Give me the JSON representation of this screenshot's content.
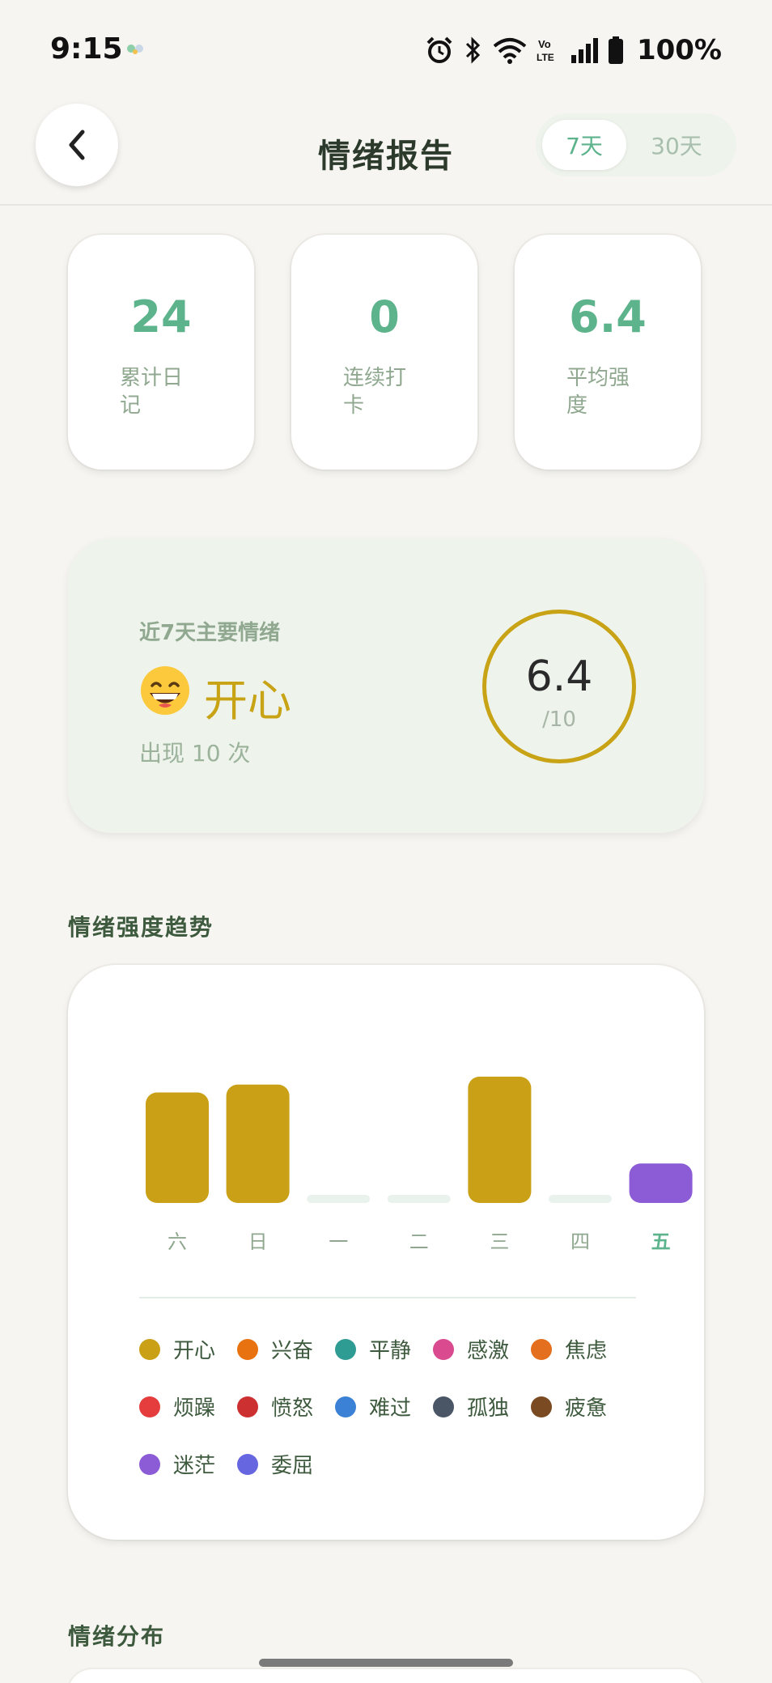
{
  "status_bar": {
    "time": "9:15",
    "battery": "100%",
    "icons": [
      "alarm-icon",
      "bluetooth-icon",
      "wifi-icon",
      "volte-icon",
      "signal-icon",
      "battery-icon"
    ]
  },
  "header": {
    "title": "情绪报告",
    "range_options": [
      "7天",
      "30天"
    ],
    "selected_range": "7天"
  },
  "stats": [
    {
      "value": "24",
      "label": "累计日记"
    },
    {
      "value": "0",
      "label": "连续打卡"
    },
    {
      "value": "6.4",
      "label": "平均强度"
    }
  ],
  "mood_summary": {
    "caption": "近7天主要情绪",
    "emoji": "grinning-face-icon",
    "mood": "开心",
    "count_text": "出现 10 次",
    "score": "6.4",
    "score_max": "/10",
    "accent_color": "#c9a316"
  },
  "trend": {
    "title": "情绪强度趋势",
    "today_index": 6,
    "colors": {
      "accent": "#5cb38c",
      "empty_bar": "#e9f2ec"
    },
    "legend": [
      {
        "label": "开心",
        "color": "#c9a016"
      },
      {
        "label": "兴奋",
        "color": "#e8720f"
      },
      {
        "label": "平静",
        "color": "#2f9c94"
      },
      {
        "label": "感激",
        "color": "#d94a8e"
      },
      {
        "label": "焦虑",
        "color": "#e46f1e"
      },
      {
        "label": "烦躁",
        "color": "#e53d3d"
      },
      {
        "label": "愤怒",
        "color": "#cc3030"
      },
      {
        "label": "难过",
        "color": "#3b82d6"
      },
      {
        "label": "孤独",
        "color": "#4a5566"
      },
      {
        "label": "疲惫",
        "color": "#7a4a22"
      },
      {
        "label": "迷茫",
        "color": "#8b5cd6"
      },
      {
        "label": "委屈",
        "color": "#6666e0"
      }
    ]
  },
  "chart_data": {
    "type": "bar",
    "categories": [
      "六",
      "日",
      "一",
      "二",
      "三",
      "四",
      "五"
    ],
    "values": [
      7,
      7.5,
      0,
      0,
      8,
      0,
      2.5
    ],
    "bar_moods": [
      "开心",
      "开心",
      "",
      "",
      "开心",
      "",
      "迷茫"
    ],
    "ylim": [
      0,
      10
    ]
  },
  "distribution": {
    "title": "情绪分布"
  }
}
